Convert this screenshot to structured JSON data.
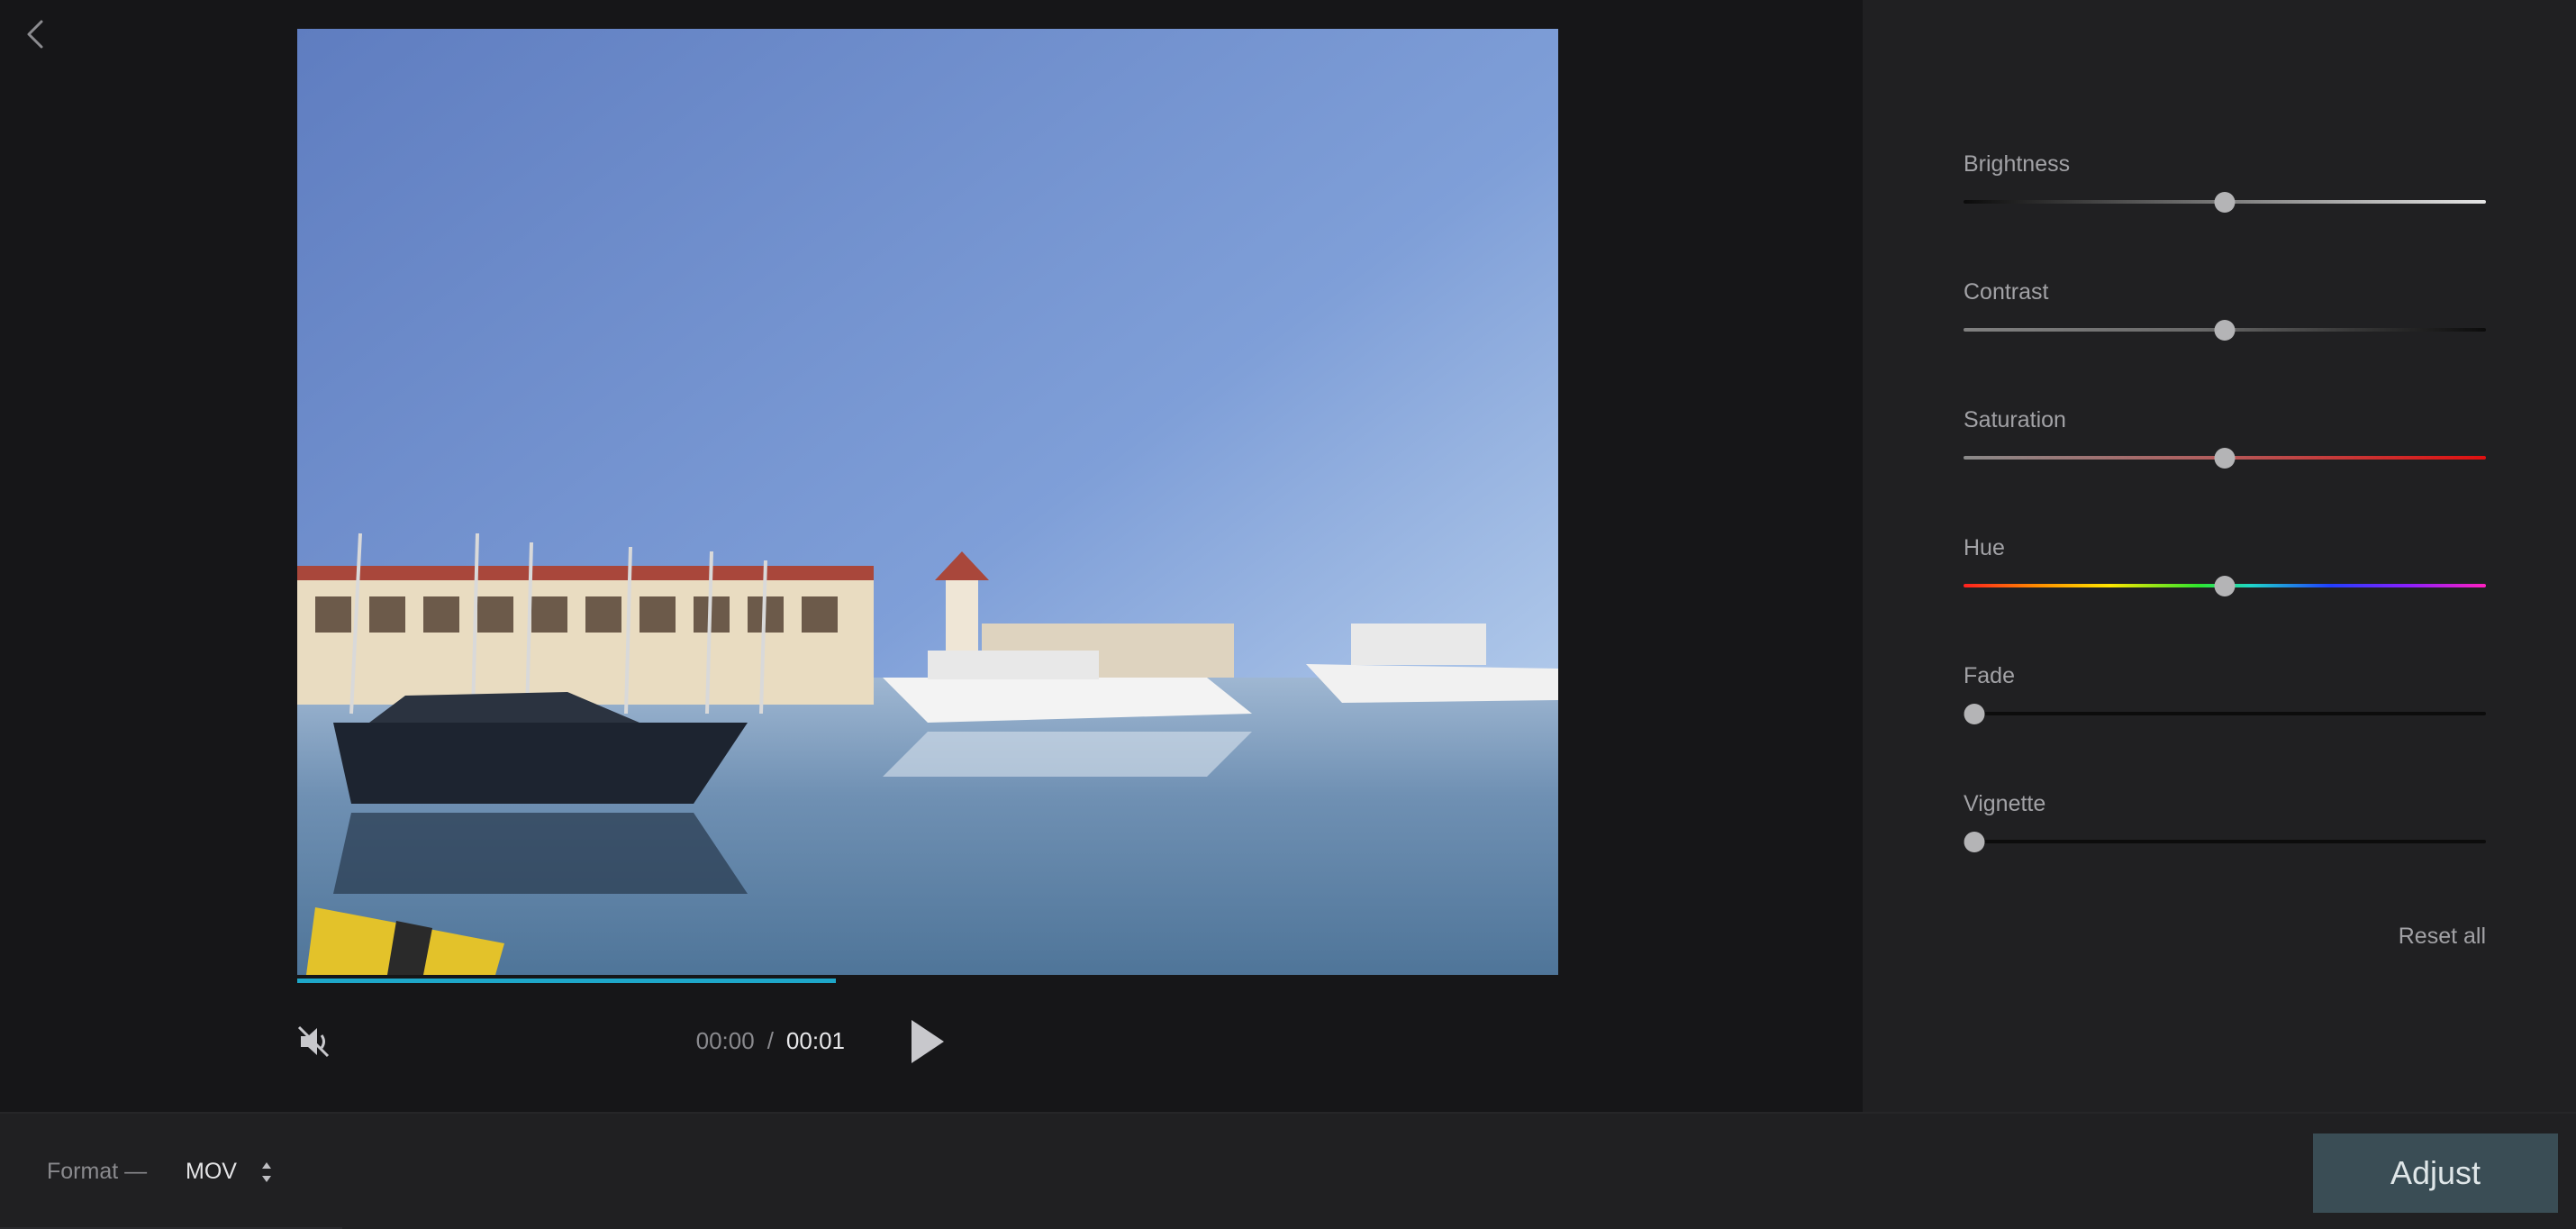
{
  "player": {
    "progress": 0.427,
    "time_current": "00:00",
    "time_separator": "/",
    "time_total": "00:01",
    "muted": true
  },
  "adjustments": [
    {
      "label": "Brightness",
      "value": 0.5,
      "track": "linear-gradient(90deg,#0b0b0b,#707070 45%,#e6e6e6)"
    },
    {
      "label": "Contrast",
      "value": 0.5,
      "track": "linear-gradient(90deg,#808080,#6a6a6a 45%,#0c0c0c)"
    },
    {
      "label": "Saturation",
      "value": 0.5,
      "track": "linear-gradient(90deg,#8a8a8a,#b06060 45%,#e01010)"
    },
    {
      "label": "Hue",
      "value": 0.5,
      "track": "linear-gradient(90deg,#ff2020,#ff8c00 14%,#ffe600 28%,#2ee62e 45%,#1fd6c8 55%,#2040ff 70%,#8a20ff 85%,#ff20c0)"
    },
    {
      "label": "Fade",
      "value": 0.02,
      "track": "linear-gradient(90deg,#0c0c0c,#0c0c0c)"
    },
    {
      "label": "Vignette",
      "value": 0.02,
      "track": "linear-gradient(90deg,#0c0c0c,#0c0c0c)"
    }
  ],
  "reset_label": "Reset all",
  "footer": {
    "format_label": "Format —",
    "format_value": "MOV",
    "adjust_label": "Adjust"
  },
  "colors": {
    "accent": "#1ea7c9",
    "adjust_button": "#3a4d55"
  },
  "icons": [
    "back-chevron-icon",
    "mute-icon",
    "play-icon",
    "sort-arrows-icon"
  ]
}
